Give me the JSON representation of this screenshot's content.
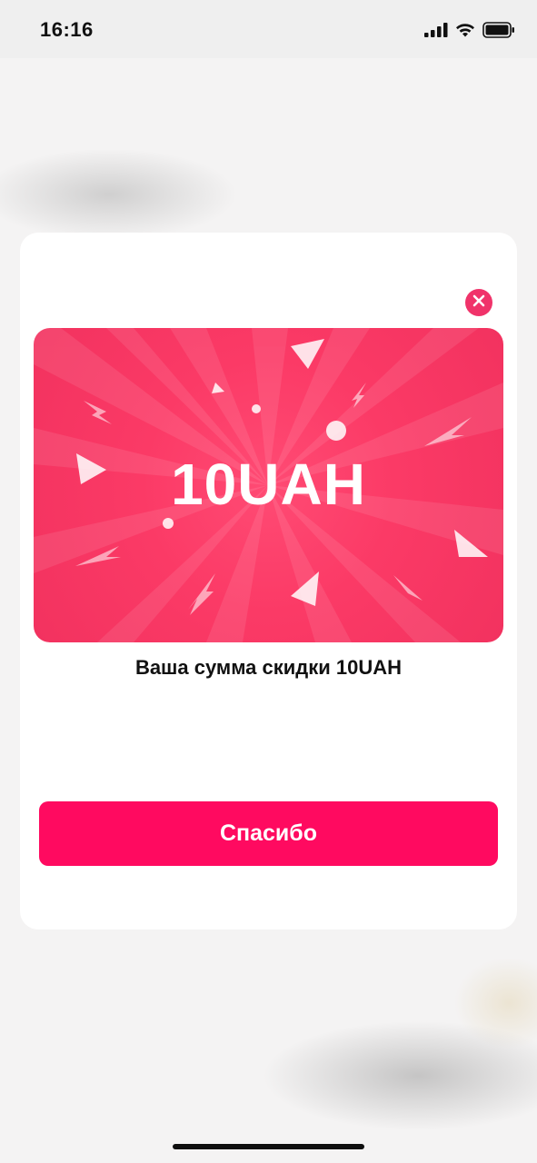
{
  "status_bar": {
    "time": "16:16",
    "icons": [
      "cellular-signal-icon",
      "wifi-icon",
      "battery-icon"
    ]
  },
  "modal": {
    "close_icon": "close-icon",
    "voucher": {
      "amount": "10UAH"
    },
    "discount_message": "Ваша сумма скидки 10UAH",
    "confirm_button_label": "Спасибо"
  },
  "colors": {
    "accent": "#ff0a60",
    "voucher_background": "#f9385f",
    "close_button": "#f0336a",
    "modal_background": "#ffffff"
  }
}
